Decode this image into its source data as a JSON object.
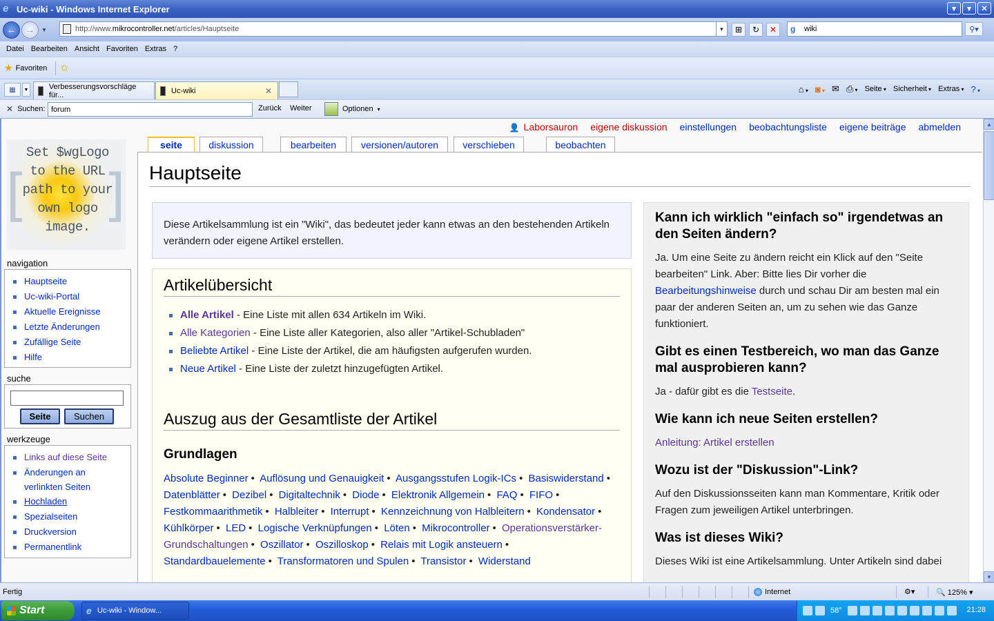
{
  "window": {
    "title": "Uc-wiki - Windows Internet Explorer",
    "buttons": [
      "min",
      "max",
      "close"
    ]
  },
  "address": {
    "url_prefix": "http://www.",
    "url_host": "mikrocontroller.net",
    "url_path": "/articles/Hauptseite",
    "search_value": "wiki"
  },
  "menu": [
    "Datei",
    "Bearbeiten",
    "Ansicht",
    "Favoriten",
    "Extras",
    "?"
  ],
  "favorites": {
    "label": "Favoriten"
  },
  "tabs": [
    {
      "label": "Verbesserungsvorschläge für..."
    },
    {
      "label": "Uc-wiki"
    }
  ],
  "commandbar": {
    "seite": "Seite",
    "sicherheit": "Sicherheit",
    "extras": "Extras"
  },
  "find": {
    "label": "Suchen:",
    "value": "forum",
    "back": "Zurück",
    "next": "Weiter",
    "options": "Optionen"
  },
  "logo": {
    "lines": [
      "Set $wgLogo",
      "to the URL",
      "path to your",
      "own logo",
      "image."
    ]
  },
  "sidebar": {
    "navigation": {
      "title": "navigation",
      "items": [
        "Hauptseite",
        "Uc-wiki-Portal",
        "Aktuelle Ereignisse",
        "Letzte Änderungen",
        "Zufällige Seite",
        "Hilfe"
      ]
    },
    "search": {
      "title": "suche",
      "btn_go": "Seite",
      "btn_search": "Suchen"
    },
    "tools": {
      "title": "werkzeuge",
      "items": [
        "Links auf diese Seite",
        "Änderungen an",
        "verlinkten Seiten",
        "Hochladen",
        "Spezialseiten",
        "Druckversion",
        "Permanentlink"
      ]
    }
  },
  "personal": [
    "Laborsauron",
    "eigene diskussion",
    "einstellungen",
    "beobachtungsliste",
    "eigene beiträge",
    "abmelden"
  ],
  "ctabs": [
    "seite",
    "diskussion",
    "bearbeiten",
    "versionen/autoren",
    "verschieben",
    "beobachten"
  ],
  "article": {
    "title": "Hauptseite",
    "intro": "Diese Artikelsammlung ist ein \"Wiki\", das bedeutet jeder kann etwas an den bestehenden Artikeln verändern oder eigene Artikel erstellen.",
    "overview": {
      "title": "Artikelübersicht",
      "items": [
        {
          "link": "Alle Artikel",
          "text": " - Eine Liste mit allen 634 Artikeln im Wiki."
        },
        {
          "link": "Alle Kategorien",
          "text": " - Eine Liste aller Kategorien, also aller \"Artikel-Schubladen\""
        },
        {
          "link": "Beliebte Artikel",
          "text": " - Eine Liste der Artikel, die am häufigsten aufgerufen wurden."
        },
        {
          "link": "Neue Artikel",
          "text": " - Eine Liste der zuletzt hinzugefügten Artikel."
        }
      ]
    },
    "list_title": "Auszug aus der Gesamtliste der Artikel",
    "basics_title": "Grundlagen",
    "basics": [
      "Absolute Beginner",
      "Auflösung und Genauigkeit",
      "Ausgangsstufen Logik-ICs",
      "Basiswiderstand",
      "Datenblätter",
      "Dezibel",
      "Digitaltechnik",
      "Diode",
      "Elektronik Allgemein",
      "FAQ",
      "FIFO",
      "Festkommaarithmetik",
      "Halbleiter",
      "Interrupt",
      "Kennzeichnung von Halbleitern",
      "Kondensator",
      "Kühlkörper",
      "LED",
      "Logische Verknüpfungen",
      "Löten",
      "Mikrocontroller",
      "Operationsverstärker-Grundschaltungen",
      "Oszillator",
      "Oszilloskop",
      "Relais mit Logik ansteuern",
      "Standardbauelemente",
      "Transformatoren und Spulen",
      "Transistor",
      "Widerstand"
    ]
  },
  "faq": {
    "q1": "Kann ich wirklich \"einfach so\" irgendetwas an den Seiten ändern?",
    "a1_pre": "Ja. Um eine Seite zu ändern reicht ein Klick auf den \"Seite bearbeiten\" Link. Aber: Bitte lies Dir vorher die ",
    "a1_link": "Bearbeitungshinweise",
    "a1_post": " durch und schau Dir am besten mal ein paar der anderen Seiten an, um zu sehen wie das Ganze funktioniert.",
    "q2": "Gibt es einen Testbereich, wo man das Ganze mal ausprobieren kann?",
    "a2_pre": "Ja - dafür gibt es die ",
    "a2_link": "Testseite",
    "a2_post": ".",
    "q3": "Wie kann ich neue Seiten erstellen?",
    "a3_link": "Anleitung: Artikel erstellen",
    "q4": "Wozu ist der \"Diskussion\"-Link?",
    "a4": "Auf den Diskussionsseiten kann man Kommentare, Kritik oder Fragen zum jeweiligen Artikel unterbringen.",
    "q5": "Was ist dieses Wiki?",
    "a5": "Dieses Wiki ist eine Artikelsammlung. Unter Artikeln sind dabei"
  },
  "status": {
    "text": "Fertig",
    "zone": "Internet",
    "zoom": "125%"
  },
  "taskbar": {
    "start": "Start",
    "item": "Uc-wiki - Window...",
    "temp": "58°",
    "clock": "21:28"
  }
}
